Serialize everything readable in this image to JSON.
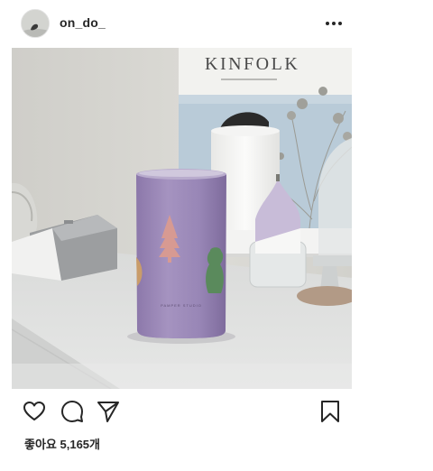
{
  "post": {
    "username": "on_do_",
    "likes_text": "좋아요 5,165개"
  },
  "photo": {
    "magazine_title": "KINFOLK",
    "cup_brand_text": "PAMPER STUDIO"
  },
  "icons": {
    "more": "more-options-icon",
    "like": "heart-icon",
    "comment": "comment-icon",
    "share": "send-icon",
    "save": "bookmark-icon"
  },
  "colors": {
    "text": "#262626",
    "smoothie": "#9a85b6",
    "wall": "#d7d6d2",
    "dresser": "#dedfdf"
  }
}
